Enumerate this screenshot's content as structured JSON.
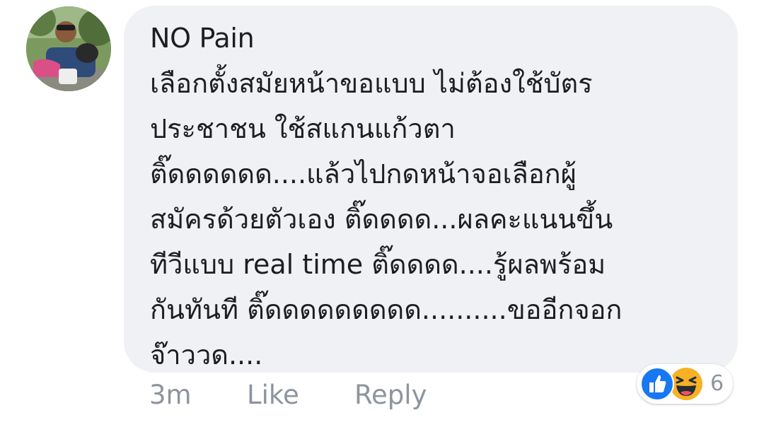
{
  "comment": {
    "author": "NO Pain",
    "text_lines": [
      "เลือกตั้งสมัยหน้าขอแบบ ไม่ต้องใช้บัตร",
      "ประชาชน ใช้สแกนแก้วตา",
      "ติ๊ดดดดดด....แล้วไปกดหน้าจอเลือกผู้",
      "สมัครด้วยตัวเอง ติ๊ดดดด...ผลคะแนนขึ้น",
      "ทีวีแบบ real time ติ๊ดดดด....รู้ผลพร้อม",
      "กันทันที ติ๊ดดดดดดดดด..........ขออีกจอก",
      "จ๊าววด...."
    ]
  },
  "actions": {
    "time": "3m",
    "like_label": "Like",
    "reply_label": "Reply"
  },
  "reactions": {
    "icons": [
      "like-icon",
      "haha-icon"
    ],
    "count": "6"
  },
  "colors": {
    "bubble": "#f0f1f4",
    "text": "#1c1e21",
    "meta": "#8d949e",
    "like_blue": "#1877f2",
    "haha_yellow": "#f7b125"
  }
}
